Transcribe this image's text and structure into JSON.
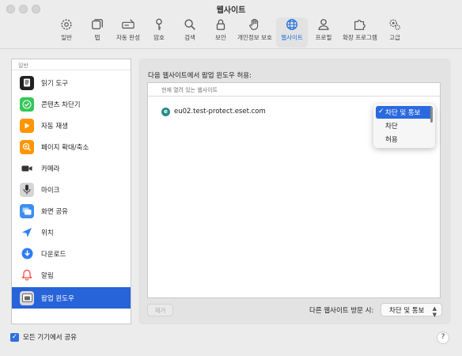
{
  "window": {
    "title": "웹사이트"
  },
  "toolbar": {
    "items": [
      {
        "label": "일반",
        "icon": "gear-icon"
      },
      {
        "label": "탭",
        "icon": "tabs-icon"
      },
      {
        "label": "자동 완성",
        "icon": "autofill-icon"
      },
      {
        "label": "암호",
        "icon": "key-icon"
      },
      {
        "label": "검색",
        "icon": "search-icon"
      },
      {
        "label": "보안",
        "icon": "lock-icon"
      },
      {
        "label": "개인정보 보호",
        "icon": "hand-icon"
      },
      {
        "label": "웹사이트",
        "icon": "globe-icon",
        "active": true
      },
      {
        "label": "프로필",
        "icon": "person-icon"
      },
      {
        "label": "확장 프로그램",
        "icon": "puzzle-icon"
      },
      {
        "label": "고급",
        "icon": "gears-icon"
      }
    ]
  },
  "sidebar": {
    "section": "일반",
    "items": [
      {
        "label": "읽기 도구",
        "icon": "reader-icon",
        "color": "#222222"
      },
      {
        "label": "콘텐츠 차단기",
        "icon": "checkmark-icon",
        "color": "#34c759"
      },
      {
        "label": "자동 재생",
        "icon": "play-icon",
        "color": "#ff9500"
      },
      {
        "label": "페이지 확대/축소",
        "icon": "zoom-icon",
        "color": "#ff9500"
      },
      {
        "label": "카메라",
        "icon": "camera-icon",
        "color": "#333333"
      },
      {
        "label": "마이크",
        "icon": "microphone-icon",
        "color": "#8e8e93"
      },
      {
        "label": "화면 공유",
        "icon": "screen-share-icon",
        "color": "#3d8ef0"
      },
      {
        "label": "위치",
        "icon": "location-arrow-icon",
        "color": "#2f7df6"
      },
      {
        "label": "다운로드",
        "icon": "download-icon",
        "color": "#2f7df6"
      },
      {
        "label": "알림",
        "icon": "bell-icon",
        "color": "#ff3b30"
      },
      {
        "label": "팝업 윈도우",
        "icon": "popup-window-icon",
        "color": "#8e8e93",
        "selected": true
      }
    ]
  },
  "main": {
    "heading": "다음 웹사이트에서 팝업 윈도우 허용:",
    "column_header": "현재 열려 있는 웹사이트",
    "rows": [
      {
        "site": "eu02.test-protect.eset.com",
        "setting": "차단 및 통보"
      }
    ],
    "dropdown_options": [
      {
        "label": "차단 및 통보",
        "selected": true
      },
      {
        "label": "차단"
      },
      {
        "label": "허용"
      }
    ],
    "remove_button": "제거",
    "other_sites_label": "다른 웹사이트 방문 시:",
    "other_sites_value": "차단 및 통보"
  },
  "footer": {
    "share_label": "모든 기기에서 공유",
    "share_checked": true,
    "help": "?"
  }
}
